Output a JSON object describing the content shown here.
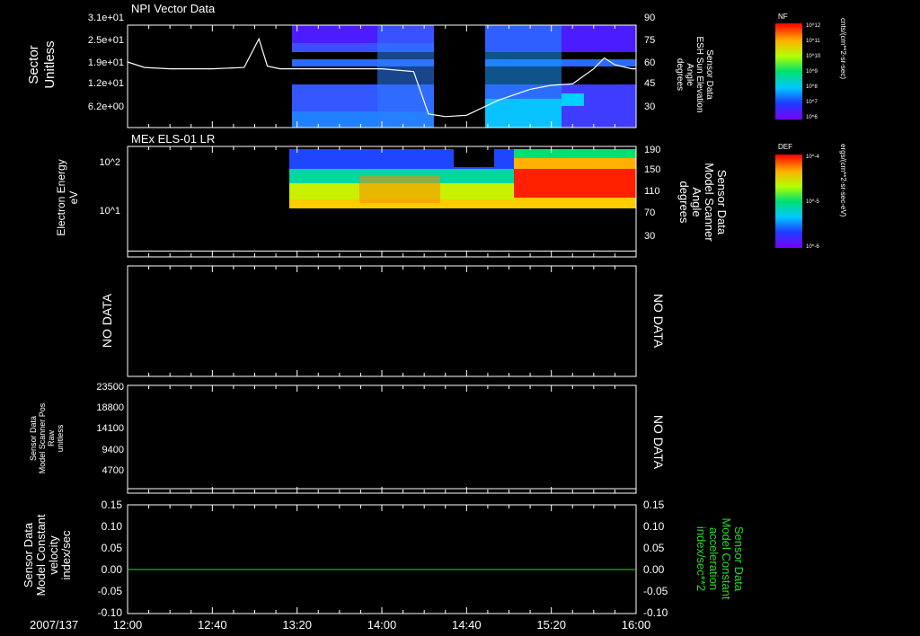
{
  "colors": {
    "background": "#000000",
    "foreground": "#ffffff",
    "accent_green": "#22dd22",
    "trace": "#ffffff"
  },
  "chart_data": [
    {
      "type": "heatmap",
      "title": "NPI Vector Data",
      "ylabel": [
        "Sector",
        "Unitless"
      ],
      "yticks": [
        "3.1e+01",
        "2.5e+01",
        "1.9e+01",
        "1.2e+01",
        "6.2e+00"
      ],
      "ylim": [
        0,
        31
      ],
      "right_axis": {
        "label": [
          "Sensor Data",
          "ESH Sun Elevation",
          "Angle",
          "degrees"
        ],
        "ticks": [
          90,
          75,
          60,
          45,
          30
        ],
        "ylim": [
          15,
          90
        ]
      },
      "series": [
        {
          "name": "ESH Sun Elevation",
          "type": "line",
          "x": [
            "12:00",
            "12:08",
            "12:20",
            "12:40",
            "12:55",
            "13:02",
            "13:06",
            "13:12",
            "13:20",
            "13:40",
            "14:00",
            "14:15",
            "14:22",
            "14:30",
            "14:40",
            "14:55",
            "15:10",
            "15:20",
            "15:30",
            "15:40",
            "15:45",
            "15:50",
            "15:58",
            "16:00"
          ],
          "y": [
            63,
            59,
            58,
            58,
            59,
            80,
            60,
            58,
            58,
            58,
            58,
            56,
            25,
            23,
            24,
            35,
            43,
            46,
            47,
            58,
            66,
            61,
            58,
            58
          ]
        }
      ],
      "colorbar": {
        "label": "NF",
        "units": "cnts/(cm**2-sr-sec)",
        "ticks": [
          "10^12",
          "10^11",
          "10^10",
          "10^9",
          "10^8",
          "10^7",
          "10^6"
        ]
      },
      "data_gaps": [
        [
          "12:00",
          "13:20"
        ],
        [
          "14:10",
          "14:40"
        ]
      ]
    },
    {
      "type": "heatmap",
      "title": "MEx ELS-01 LR",
      "ylabel": [
        "Electron Energy",
        "eV"
      ],
      "yticks": [
        "10^2",
        "10^1"
      ],
      "scale": "log",
      "right_axis": {
        "label": [
          "Sensor Data",
          "Model Scanner",
          "Angle",
          "degrees"
        ],
        "ticks": [
          190,
          150,
          110,
          70,
          30
        ],
        "ylim": [
          0,
          190
        ]
      },
      "series": [
        {
          "name": "Model Scanner Angle",
          "type": "line",
          "x": [
            "12:00",
            "16:00"
          ],
          "y": [
            10,
            10
          ]
        }
      ],
      "colorbar": {
        "label": "DEF",
        "units": "ergs/(cm**2-sr-sec-eV)",
        "ticks": [
          "10^-4",
          "10^-5",
          "10^-6"
        ]
      },
      "data_gaps": [
        [
          "12:00",
          "13:20"
        ]
      ]
    },
    {
      "type": "line",
      "left_text": "NO DATA",
      "right_text": "NO DATA"
    },
    {
      "type": "line",
      "ylabel": [
        "Sensor Data",
        "Model Scanner Pos",
        "Raw",
        "unitless"
      ],
      "yticks": [
        23500,
        18800,
        14100,
        9400,
        4700
      ],
      "ylim": [
        0,
        23500
      ],
      "series": [
        {
          "type": "line",
          "x": [
            "12:00",
            "16:00"
          ],
          "y": [
            0,
            0
          ]
        }
      ],
      "right_text": "NO DATA"
    },
    {
      "type": "line",
      "ylabel": [
        "Sensor Data",
        "Model Constant",
        "velocity",
        "index/sec"
      ],
      "yticks": [
        "0.15",
        "0.10",
        "0.05",
        "0.00",
        "-0.05",
        "-0.10"
      ],
      "ylim": [
        -0.1,
        0.15
      ],
      "right_axis": {
        "label": [
          "Sensor Data",
          "Model Constant",
          "acceleration",
          "index/sec**2"
        ],
        "ticks": [
          "0.15",
          "0.10",
          "0.05",
          "0.00",
          "-0.05",
          "-0.10"
        ]
      },
      "series": [
        {
          "type": "line",
          "x": [
            "12:00",
            "16:00"
          ],
          "y": [
            0,
            0
          ]
        }
      ]
    }
  ],
  "time_axis": {
    "date": "2007/137",
    "ticks": [
      "12:00",
      "12:40",
      "13:20",
      "14:00",
      "14:40",
      "15:20",
      "16:00"
    ]
  }
}
